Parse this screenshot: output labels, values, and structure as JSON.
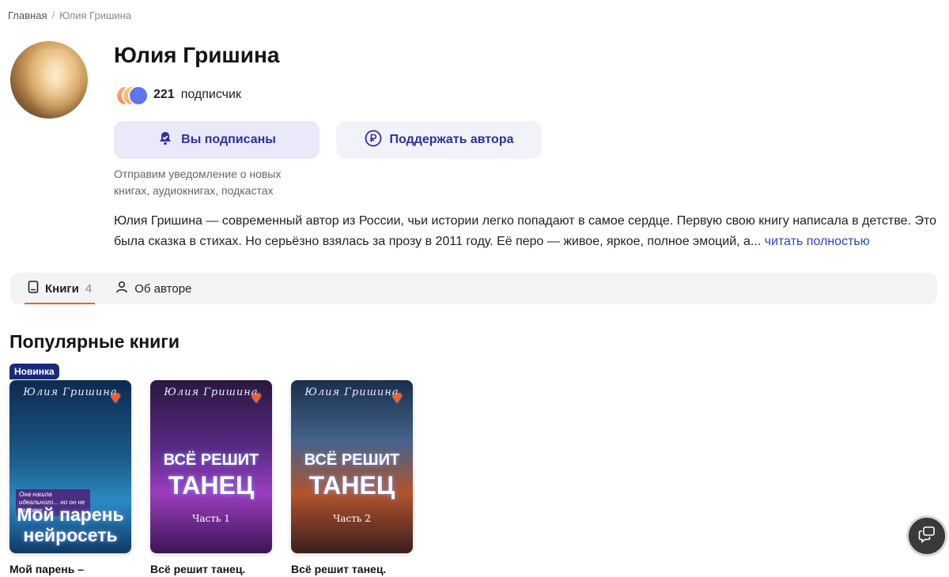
{
  "breadcrumb": {
    "home": "Главная",
    "separator": "/",
    "current": "Юлия Гришина"
  },
  "author": {
    "name": "Юлия Гришина",
    "subscribers_count": "221",
    "subscribers_label": "подписчик",
    "subscribe_button": "Вы подписаны",
    "support_button": "Поддержать автора",
    "notice": "Отправим уведомление о новых книгах, аудиокнигах, подкастах",
    "bio": "Юлия Гришина — современный автор из России, чьи истории легко попадают в самое сердце. Первую свою книгу написала в детстве. Это была сказка в стихах. Но серьёзно взялась за прозу в 2011 году. Её перо — живое, яркое, полное эмоций, а...",
    "read_more": "читать полностью"
  },
  "tabs": [
    {
      "label": "Книги",
      "count": "4"
    },
    {
      "label": "Об авторе"
    }
  ],
  "section": {
    "title": "Популярные книги"
  },
  "books": [
    {
      "badge": "Новинка",
      "cover_author": "Юлия Гришина",
      "cover_tagline": "Она нашла идеального... но он не человек",
      "cover_title": "Мой парень нейросеть",
      "title": "Мой парень –"
    },
    {
      "cover_author": "Юлия Гришина",
      "cover_title_top": "ВСЁ РЕШИТ",
      "cover_title_bottom": "ТАНЕЦ",
      "cover_part": "Часть 1",
      "title": "Всё решит танец."
    },
    {
      "cover_author": "Юлия Гришина",
      "cover_title_top": "ВСЁ РЕШИТ",
      "cover_title_bottom": "ТАНЕЦ",
      "cover_part": "Часть 2",
      "title": "Всё решит танец."
    }
  ],
  "icons": {
    "subscribed": "bell-check-icon",
    "support": "ruble-icon",
    "books_tab": "book-icon",
    "about_tab": "person-icon",
    "favorite": "heart-icon",
    "chat": "chat-icon"
  },
  "colors": {
    "accent": "#ff5a1f",
    "button_text": "#2f2fa2",
    "link": "#2b3fcf",
    "badge": "#1a2a7a"
  }
}
